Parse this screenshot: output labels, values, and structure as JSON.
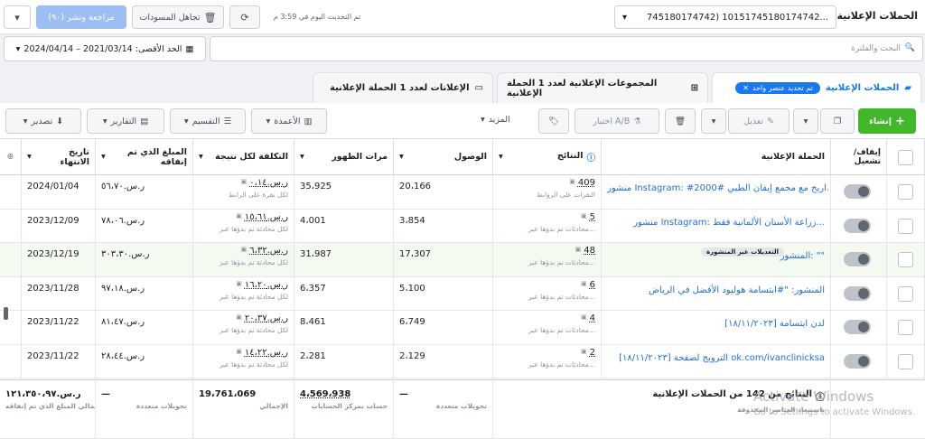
{
  "topbar": {
    "title": "الحملات الإعلانية",
    "account_selector": "745180174742) 10151745180174742...",
    "update_status": "تم التحديث اليوم في 3:59 م",
    "discard_drafts": "تجاهل المسودات",
    "review_publish": "مراجعة ونشر (٩٠)"
  },
  "search": {
    "placeholder": "البحث والفلترة",
    "date_range": "الحد الأقصى: 2021/03/14 – 2024/04/14"
  },
  "tabs": {
    "campaigns": "الحملات الإعلانية",
    "selected_chip": "تم تحديد عنصر واحد",
    "adsets": "المجموعات الإعلانية لعدد 1 الحملة الإعلانية",
    "ads": "الإعلانات لعدد 1 الحملة الإعلانية"
  },
  "toolbar": {
    "create": "إنشاء",
    "edit": "تعديل",
    "ab_test": "اختبار A/B",
    "more": "المزيد",
    "columns": "الأعمدة",
    "breakdown": "التقسيم",
    "reports": "التقارير",
    "export": "تصدير"
  },
  "columns": {
    "toggle": "إيقاف/تشغيل",
    "campaign": "الحملة الإعلانية",
    "results": "النتائج",
    "reach": "الوصول",
    "impressions": "مرات الظهور",
    "cost_per_result": "التكلفة لكل نتيجة",
    "amount_spent": "المبلغ الذي تم إنفاقه",
    "end_date": "تاريخ الانتهاء"
  },
  "rows": [
    {
      "name": "منشور Instagram: #اربح مع مجمع إيفان الطبي #2000...",
      "results": "409",
      "results_sub": "النقرات على الروابط",
      "reach": "20،166",
      "impressions": "35،925",
      "cost": "ر.س.٠،١٤",
      "cost_sub": "لكل نقرة على الرابط",
      "spent": "ر.س.٥٦،٧٠",
      "end": "2024/01/04"
    },
    {
      "name": "منشور Instagram: زراعة الأسنان الألمانية فقط...",
      "results": "5",
      "results_sub": "محادثات تم بدؤها عبر...",
      "reach": "3،854",
      "impressions": "4،001",
      "cost": "ر.س.١٥،٦١",
      "cost_sub": "لكل محادثة تم بدؤها عبر",
      "spent": "ر.س.٧٨،٠٦",
      "end": "2023/12/09"
    },
    {
      "name": "المنشور: \"\"",
      "badge": "التعديلات غير المنشورة",
      "results": "48",
      "results_sub": "محادثات تم بدؤها عبر...",
      "reach": "17،307",
      "impressions": "31،987",
      "cost": "ر.س.٦،٣٢",
      "cost_sub": "لكل محادثة تم بدؤها عبر",
      "spent": "ر.س.٣٠٣،٣٠",
      "end": "2023/12/19"
    },
    {
      "name": "المنشور: \"#ابتسامة هوليود الأفضل في الرياض",
      "results": "6",
      "results_sub": "محادثات تم بدؤها عبر...",
      "reach": "5،100",
      "impressions": "6،357",
      "cost": "ر.س.١٦،٢٠",
      "cost_sub": "لكل محادثة تم بدؤها عبر",
      "spent": "ر.س.٩٧،١٨",
      "end": "2023/11/28"
    },
    {
      "name": "[١٨/١١/٢٠٢٣] لدن ابتسامة",
      "results": "4",
      "results_sub": "محادثات تم بدؤها عبر...",
      "reach": "6،749",
      "impressions": "8،461",
      "cost": "ر.س.٢٠،٣٧",
      "cost_sub": "لكل محادثة تم بدؤها عبر",
      "spent": "ر.س.٨١،٤٧",
      "end": "2023/11/22"
    },
    {
      "name": "[١٨/١١/٢٠٢٣] الترويج لصفحة ok.com/ivanclinicksa",
      "results": "2",
      "results_sub": "محادثات تم بدؤها عبر...",
      "reach": "2،129",
      "impressions": "2،281",
      "cost": "ر.س.١٤،٢٢",
      "cost_sub": "لكل محادثة تم بدؤها عبر",
      "spent": "ر.س.٢٨،٤٤",
      "end": "2023/11/22"
    }
  ],
  "totals": {
    "label": "النتائج من 142 من الحملات الإعلانية",
    "label_sub": "باستبعاد العناصر المحذوفة",
    "results": "—",
    "results_sub": "تحويلات متعددة",
    "reach": "4،569،938",
    "reach_sub": "حساب بمركز الحسابات",
    "impressions": "19،761،069",
    "impressions_sub": "الإجمالي",
    "cost": "—",
    "cost_sub": "تحويلات متعددة",
    "spent": "ر.س.١٢١،٣٥٠،٩٧",
    "spent_sub": "إجمالي المبلغ الذي تم إنفاقه"
  },
  "watermark": {
    "line1": "Activate Windows",
    "line2": "Go to Settings to activate Windows."
  }
}
